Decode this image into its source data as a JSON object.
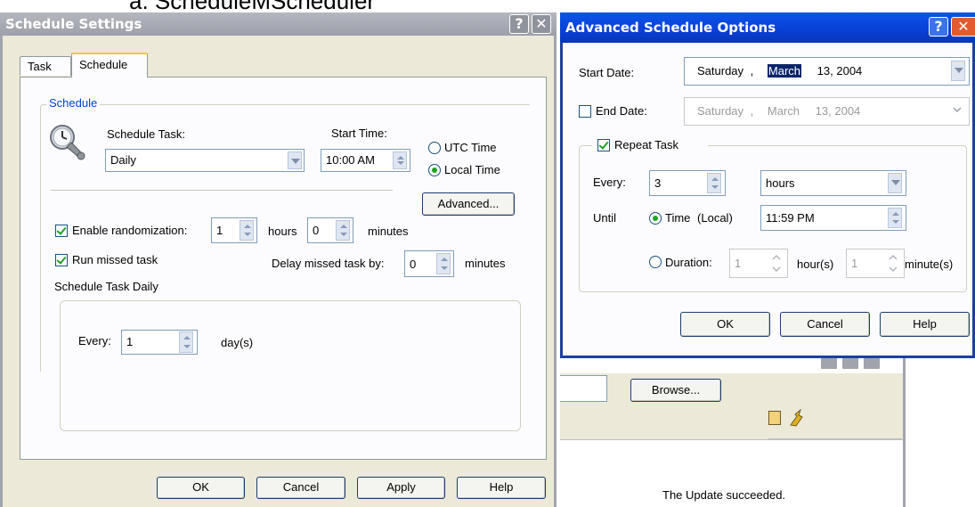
{
  "caption": "a.  ScheduleMScheduler",
  "schedule_settings": {
    "title": "Schedule Settings",
    "help_glyph": "?",
    "close_glyph": "✕",
    "tabs": [
      {
        "label": "Task"
      },
      {
        "label": "Schedule"
      }
    ],
    "group_label": "Schedule",
    "schedule_task_label": "Schedule Task:",
    "schedule_task_value": "Daily",
    "start_time_label": "Start Time:",
    "start_time_value": "10:00 AM",
    "utc_time_label": "UTC Time",
    "local_time_label": "Local Time",
    "advanced_button": "Advanced...",
    "enable_randomization_label": "Enable randomization:",
    "random_hours_value": "1",
    "hours_label": "hours",
    "random_minutes_value": "0",
    "minutes_label": "minutes",
    "run_missed_label": "Run missed task",
    "delay_label": "Delay missed task by:",
    "delay_value": "0",
    "delay_minutes_label": "minutes",
    "daily_group_label": "Schedule Task Daily",
    "every_label": "Every:",
    "every_value": "1",
    "days_label": "day(s)",
    "buttons": {
      "ok": "OK",
      "cancel": "Cancel",
      "apply": "Apply",
      "help": "Help"
    }
  },
  "advanced_options": {
    "title": "Advanced Schedule Options",
    "help_glyph": "?",
    "close_glyph": "✕",
    "start_date_label": "Start Date:",
    "start_date": {
      "weekday": "Saturday",
      "sep": ",",
      "month": "March",
      "day_year": "13, 2004"
    },
    "end_date_label": "End Date:",
    "end_date": {
      "weekday": "Saturday",
      "sep": ",",
      "month": "March",
      "day_year": "13, 2004"
    },
    "repeat_task_label": "Repeat Task",
    "every_label": "Every:",
    "every_value": "3",
    "every_unit": "hours",
    "until_label": "Until",
    "time_label": "Time",
    "time_qualifier": "(Local)",
    "time_value": "11:59 PM",
    "duration_label": "Duration:",
    "duration_hours_value": "1",
    "duration_hours_label": "hour(s)",
    "duration_minutes_value": "1",
    "duration_minutes_label": "minute(s)",
    "buttons": {
      "ok": "OK",
      "cancel": "Cancel",
      "help": "Help"
    }
  },
  "background_window": {
    "browse_button": "Browse...",
    "status_text": "The Update succeeded."
  },
  "colors": {
    "titlebar_blue": "#0a3fd6",
    "titlebar_gray": "#a1a4ad",
    "panel_bg": "#ece9d8",
    "dialog_border": "#1e3f9e",
    "check_green": "#21a121"
  }
}
